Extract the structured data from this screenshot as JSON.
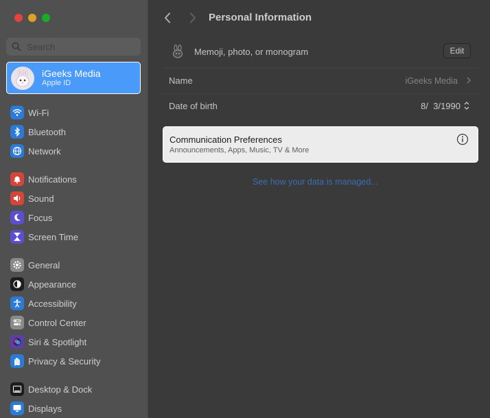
{
  "window": {
    "traffic_lights": [
      "#e0443e",
      "#dea123",
      "#1aab29"
    ]
  },
  "sidebar": {
    "search_placeholder": "Search",
    "account": {
      "name": "iGeeks Media",
      "subtitle": "Apple ID"
    },
    "items": [
      {
        "label": "Wi-Fi",
        "icon": "wifi-icon",
        "color": "#2b7bd6"
      },
      {
        "label": "Bluetooth",
        "icon": "bluetooth-icon",
        "color": "#2b7bd6"
      },
      {
        "label": "Network",
        "icon": "network-globe-icon",
        "color": "#2b7bd6"
      },
      {
        "label": "Notifications",
        "icon": "notifications-bell-icon",
        "color": "#d4453a"
      },
      {
        "label": "Sound",
        "icon": "sound-speaker-icon",
        "color": "#d4453a"
      },
      {
        "label": "Focus",
        "icon": "focus-moon-icon",
        "color": "#5b4fd0"
      },
      {
        "label": "Screen Time",
        "icon": "screen-time-hourglass-icon",
        "color": "#5b4fd0"
      },
      {
        "label": "General",
        "icon": "general-gear-icon",
        "color": "#8a8a8a"
      },
      {
        "label": "Appearance",
        "icon": "appearance-icon",
        "color": "#1d1d1d"
      },
      {
        "label": "Accessibility",
        "icon": "accessibility-icon",
        "color": "#2b7bd6"
      },
      {
        "label": "Control Center",
        "icon": "control-center-icon",
        "color": "#8a8a8a"
      },
      {
        "label": "Siri & Spotlight",
        "icon": "siri-icon",
        "color": "#5a3fa8"
      },
      {
        "label": "Privacy & Security",
        "icon": "privacy-hand-icon",
        "color": "#2b7bd6"
      },
      {
        "label": "Desktop & Dock",
        "icon": "desktop-dock-icon",
        "color": "#1d1d1d"
      },
      {
        "label": "Displays",
        "icon": "displays-icon",
        "color": "#2b7bd6"
      }
    ]
  },
  "header": {
    "title": "Personal Information"
  },
  "main": {
    "memoji_label": "Memoji, photo, or monogram",
    "edit_label": "Edit",
    "name_label": "Name",
    "name_value": "iGeeks Media",
    "dob_label": "Date of birth",
    "dob_value": "8/  3/1990",
    "comm_title": "Communication Preferences",
    "comm_subtitle": "Announcements, Apps, Music, TV & More",
    "data_link": "See how your data is managed..."
  }
}
